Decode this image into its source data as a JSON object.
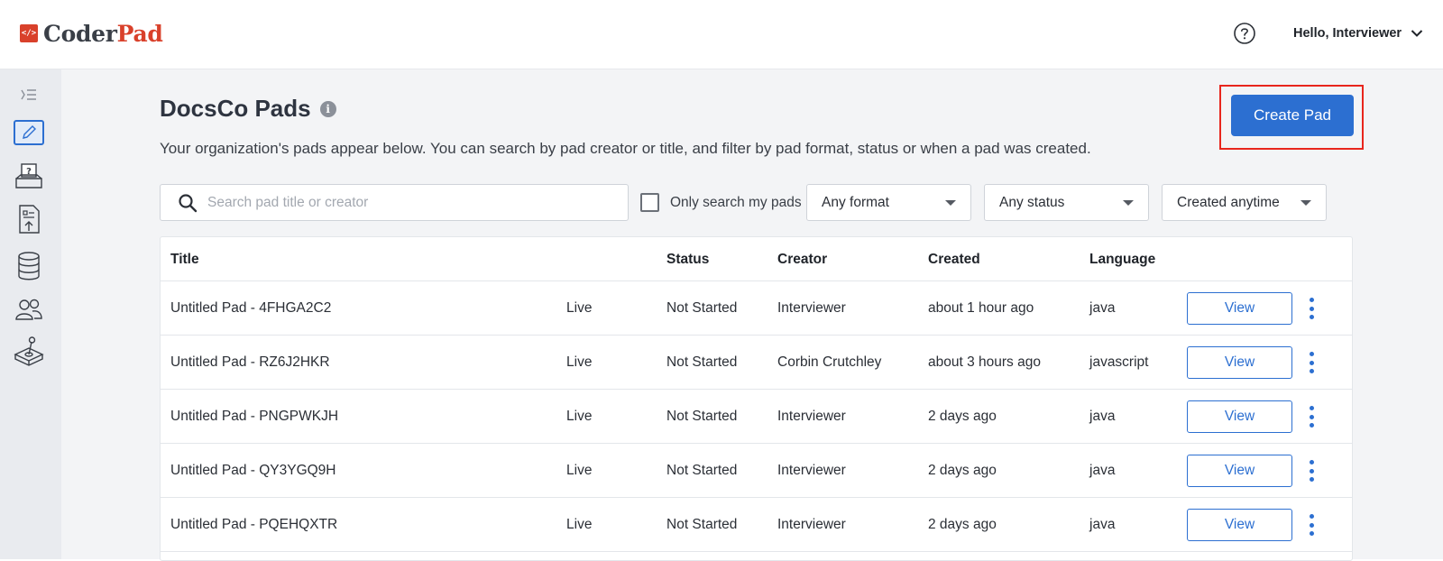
{
  "header": {
    "logo_prefix": "Coder",
    "logo_suffix": "Pad",
    "logo_mark": "</>",
    "help_icon": "question-circle-icon",
    "user_greeting": "Hello, Interviewer"
  },
  "sidebar": {
    "items": [
      {
        "name": "collapse-icon"
      },
      {
        "name": "pads-icon",
        "active": true
      },
      {
        "name": "questions-icon"
      },
      {
        "name": "take-homes-icon"
      },
      {
        "name": "databases-icon"
      },
      {
        "name": "team-icon"
      },
      {
        "name": "sandbox-icon"
      }
    ]
  },
  "page": {
    "title": "DocsCo Pads",
    "info_glyph": "i",
    "description": "Your organization's pads appear below. You can search by pad creator or title, and filter by pad format, status or when a pad was created.",
    "create_label": "Create Pad"
  },
  "filters": {
    "search_placeholder": "Search pad title or creator",
    "search_value": "",
    "only_mine_label": "Only search my pads",
    "only_mine_checked": false,
    "format": "Any format",
    "status": "Any status",
    "created": "Created anytime"
  },
  "table": {
    "headers": {
      "title": "Title",
      "status": "Status",
      "creator": "Creator",
      "created": "Created",
      "language": "Language"
    },
    "view_label": "View",
    "rows": [
      {
        "title": "Untitled Pad - 4FHGA2C2",
        "mode": "Live",
        "status": "Not Started",
        "creator": "Interviewer",
        "created": "about 1 hour ago",
        "language": "java"
      },
      {
        "title": "Untitled Pad - RZ6J2HKR",
        "mode": "Live",
        "status": "Not Started",
        "creator": "Corbin Crutchley",
        "created": "about 3 hours ago",
        "language": "javascript"
      },
      {
        "title": "Untitled Pad - PNGPWKJH",
        "mode": "Live",
        "status": "Not Started",
        "creator": "Interviewer",
        "created": "2 days ago",
        "language": "java"
      },
      {
        "title": "Untitled Pad - QY3YGQ9H",
        "mode": "Live",
        "status": "Not Started",
        "creator": "Interviewer",
        "created": "2 days ago",
        "language": "java"
      },
      {
        "title": "Untitled Pad - PQEHQXTR",
        "mode": "Live",
        "status": "Not Started",
        "creator": "Interviewer",
        "created": "2 days ago",
        "language": "java"
      }
    ]
  },
  "colors": {
    "brand_red": "#d9412b",
    "primary_blue": "#2c6fd1",
    "highlight_red": "#e8261d"
  }
}
